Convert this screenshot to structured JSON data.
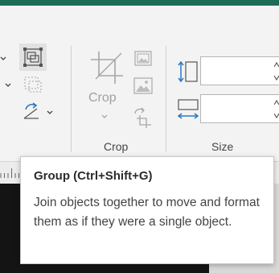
{
  "ribbon": {
    "crop_button_label": "Crop",
    "crop_group_label": "Crop",
    "size_group_label": "Size"
  },
  "tooltip": {
    "title": "Group (Ctrl+Shift+G)",
    "description": "Join objects together to move and format them as if they were a single object."
  },
  "colors": {
    "title_bar": "#1e6b57",
    "accent_blue": "#2b79c2",
    "selected_bg": "#e1e1e1"
  }
}
